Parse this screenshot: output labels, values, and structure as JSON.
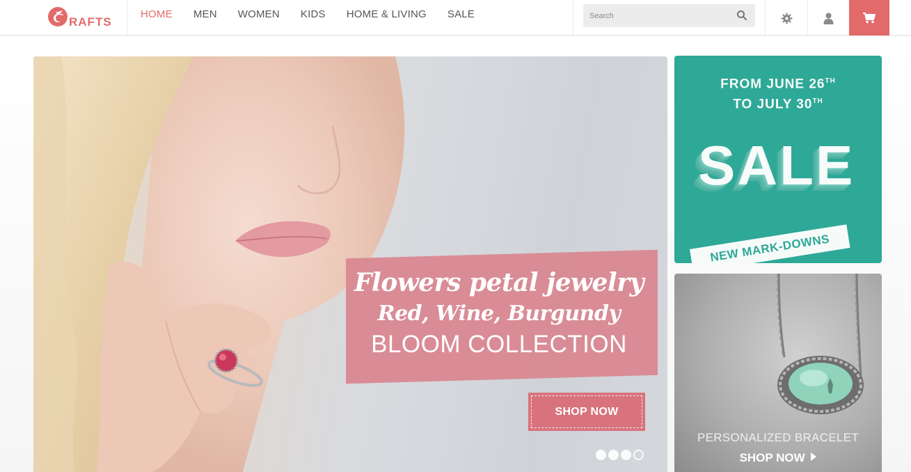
{
  "brand": {
    "logo_text": "RAFTS",
    "accent": "#e36a6a"
  },
  "nav": {
    "items": [
      {
        "label": "HOME",
        "active": true
      },
      {
        "label": "MEN"
      },
      {
        "label": "WOMEN"
      },
      {
        "label": "KIDS"
      },
      {
        "label": "HOME & LIVING"
      },
      {
        "label": "SALE"
      }
    ]
  },
  "search": {
    "placeholder": "Search",
    "icon": "search-icon"
  },
  "header_icons": [
    "gear-icon",
    "user-icon",
    "cart-icon"
  ],
  "hero": {
    "line1": "Flowers petal jewelry",
    "line2": "Red, Wine, Burgundy",
    "line3": "BLOOM COLLECTION",
    "cta": "SHOP NOW",
    "slide_count": 4,
    "active_slide": 4,
    "banner_color": "#d9858f"
  },
  "sale_tile": {
    "date_line1": "FROM JUNE 26",
    "date_line1_sup": "TH",
    "date_line2": "TO JULY 30",
    "date_line2_sup": "TH",
    "big": "SALE",
    "strip": "NEW MARK-DOWNS",
    "color": "#2ea897"
  },
  "bracelet_tile": {
    "label": "PERSONALIZED BRACELET",
    "cta": "SHOP NOW"
  }
}
